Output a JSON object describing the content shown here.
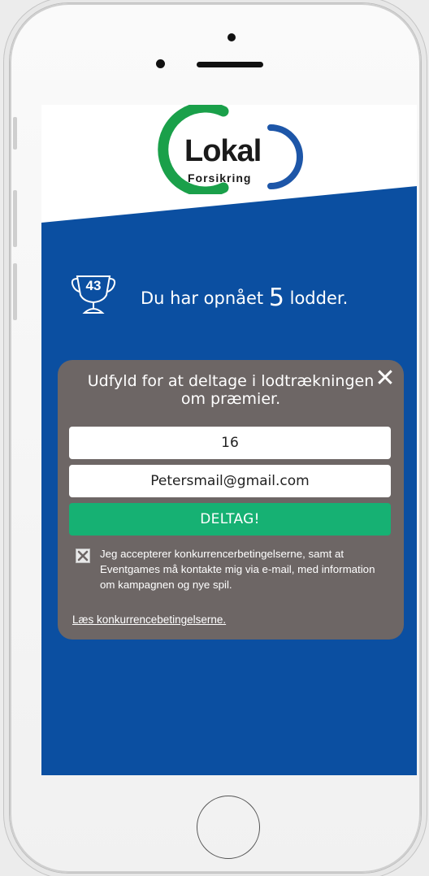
{
  "logo": {
    "brand": "Lokal",
    "sub": "Forsikring"
  },
  "score": {
    "trophy_number": "43",
    "prefix": "Du har opnået",
    "count": "5",
    "suffix": "lodder."
  },
  "form": {
    "title": "Udfyld for at deltage i lodtrækningen om præmier.",
    "close_label": "✕",
    "age_value": "16",
    "email_value": "Petersmail@gmail.com",
    "submit_label": "DELTAG!",
    "consent_checked": true,
    "consent_text": "Jeg accepterer konkurrencerbetingelserne, samt at Eventgames må kontakte mig via e-mail, med information om kampagnen og nye spil.",
    "terms_link": "Læs konkurrencebetingelserne."
  },
  "colors": {
    "background_blue": "#0b4fa1",
    "card_gray": "#6d6665",
    "button_green": "#16b173",
    "logo_green": "#1aa04a",
    "logo_blue": "#1d56a8"
  },
  "icons": [
    "trophy-icon",
    "close-icon",
    "checkbox-icon"
  ]
}
